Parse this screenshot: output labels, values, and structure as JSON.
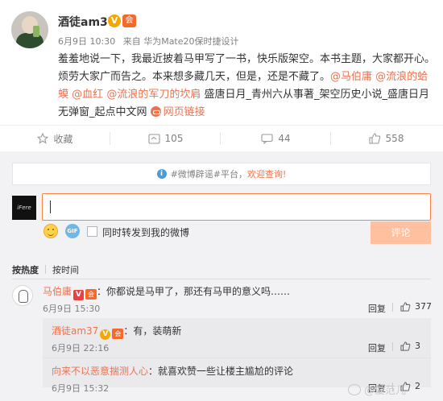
{
  "post": {
    "author": "酒徒am37",
    "verified_badge": "V",
    "member_badge": "会",
    "date": "6月9日 10:30",
    "source": "来自 华为Mate20保时捷设计",
    "content_plain": "羞羞地说一下，我最近披着马甲写了一书，快乐版架空。本书主题，大家都开心。烦劳大家广而告之。本来想多藏几天，但是，还是不藏了。",
    "mentions": [
      "@马伯庸",
      "@流浪的蛤蟆",
      "@血红",
      "@流浪的军刀的坎肩"
    ],
    "content_tail": "盛唐日月_青州六从事著_架空历史小说_盛唐日月无弹窗_起点中文网",
    "web_link": "网页链接",
    "accent_color": "#eb7350"
  },
  "actions": {
    "favorite": {
      "label": "收藏",
      "icon": "star-icon"
    },
    "repost": {
      "count": "105",
      "icon": "repost-icon"
    },
    "comment": {
      "count": "44",
      "icon": "comment-icon"
    },
    "like": {
      "count": "558",
      "icon": "thumbs-up-icon"
    }
  },
  "comment_box": {
    "notice_prefix": "#微博辟谣#平台，",
    "notice_link": "欢迎查询!",
    "my_avatar_text": "iFere",
    "input_value": "",
    "repost_checkbox_label": "同时转发到我的微博",
    "submit_label": "评论",
    "submit_color": "#ffc09f"
  },
  "sort": {
    "active": "按热度",
    "other": "按时间"
  },
  "comments": [
    {
      "user": "马伯庸",
      "text": "：你都说是马甲了，那还有马甲的意义吗……",
      "time": "6月9日 15:30",
      "reply": "回复",
      "likes": "377",
      "replies": [
        {
          "user": "酒徒am37",
          "text": "：有，装萌新",
          "time": "6月9日 22:16",
          "reply": "回复",
          "likes": "3"
        },
        {
          "user": "向来不以恶意揣测人心",
          "text": "：就喜欢赞一些让楼主尴尬的评论",
          "time": "6月9日 15:32",
          "reply": "回复",
          "likes": "2"
        }
      ]
    }
  ],
  "watermark": "@爱范儿"
}
